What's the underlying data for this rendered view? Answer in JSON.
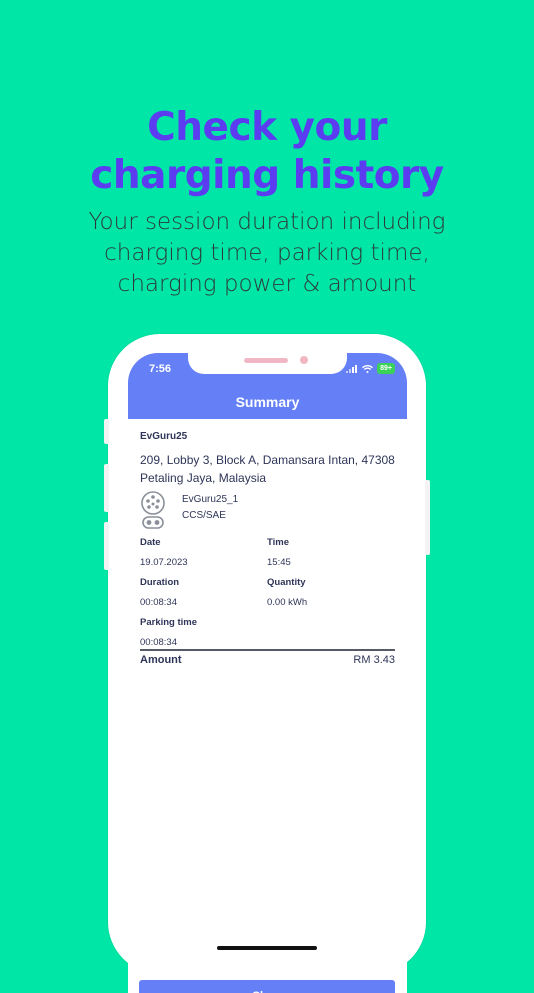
{
  "promo": {
    "headline_line1": "Check your",
    "headline_line2": "charging history",
    "sub_line1": "Your session duration including",
    "sub_line2": "charging time, parking time,",
    "sub_line3": "charging power & amount"
  },
  "status_bar": {
    "time": "7:56",
    "battery": "89+"
  },
  "screen": {
    "title": "Summary"
  },
  "session": {
    "station_name": "EvGuru25",
    "address": "209, Lobby 3, Block A, Damansara Intan, 47308 Petaling Jaya, Malaysia",
    "connector_name": "EvGuru25_1",
    "connector_type": "CCS/SAE",
    "date_label": "Date",
    "date_value": "19.07.2023",
    "time_label": "Time",
    "time_value": "15:45",
    "duration_label": "Duration",
    "duration_value": "00:08:34",
    "quantity_label": "Quantity",
    "quantity_value": "0.00 kWh",
    "parking_label": "Parking time",
    "parking_value": "00:08:34",
    "amount_label": "Amount",
    "amount_value": "RM 3.43"
  },
  "actions": {
    "close_label": "Close"
  },
  "colors": {
    "background": "#00E6A6",
    "headline": "#5B3CF0",
    "app_primary": "#6580F7",
    "text_dark": "#2E3558"
  },
  "icons": [
    "signal-icon",
    "wifi-icon",
    "battery-icon",
    "ccs-connector-icon"
  ]
}
